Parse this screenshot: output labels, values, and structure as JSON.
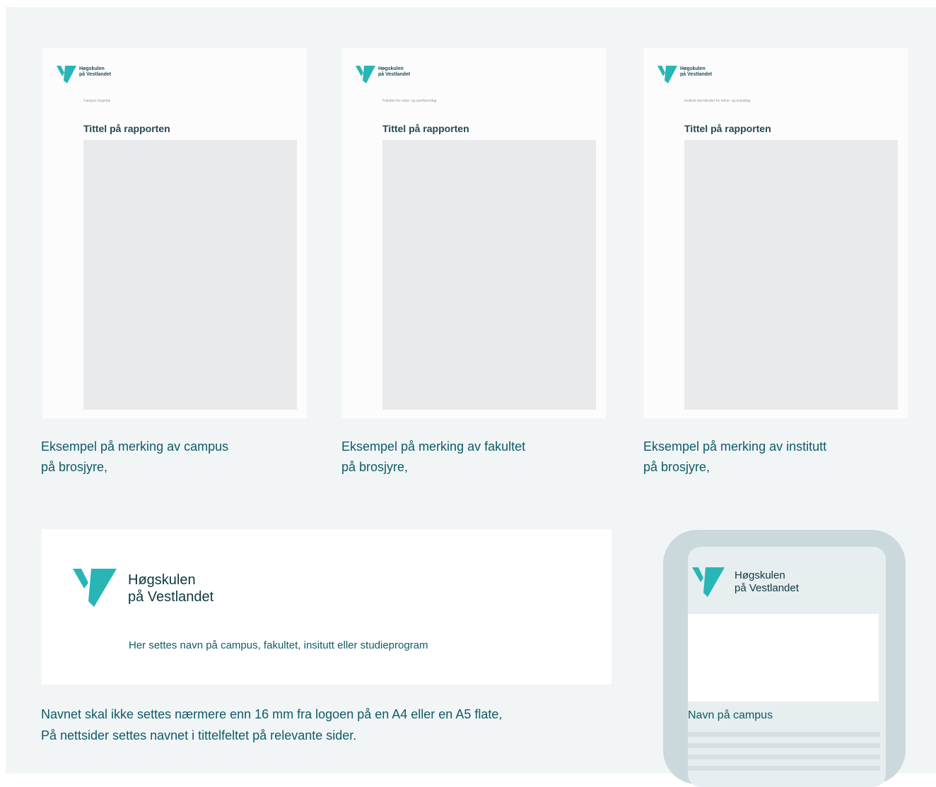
{
  "brand": {
    "name_line1": "Høgskulen",
    "name_line2": "på Vestlandet",
    "accent": "#29b5b6",
    "dark": "#0e3840"
  },
  "cards": [
    {
      "unit": "Campus Sogndal",
      "title": "Tittel på rapporten",
      "caption_line1": "Eksempel på merking av campus",
      "caption_line2": "på brosjyre,"
    },
    {
      "unit": "Fakultet for natur- og samfunnsfag",
      "title": "Tittel på rapporten",
      "caption_line1": "Eksempel på merking av fakultet",
      "caption_line2": "på brosjyre,"
    },
    {
      "unit": "Institutt ved fakultet for helse- og sosialfag",
      "title": "Tittel på rapporten",
      "caption_line1": "Eksempel på merking av institutt",
      "caption_line2": "på brosjyre,"
    }
  ],
  "banner": {
    "hint": "Her settes navn på campus, fakultet, insitutt eller studieprogram"
  },
  "note": {
    "line1": "Navnet skal ikke settes nærmere enn 16 mm fra logoen på en A4 eller en A5 flate,",
    "line2": "På nettsider settes navnet i tittelfeltet på relevante sider."
  },
  "phone": {
    "campus_label": "Navn på campus"
  }
}
